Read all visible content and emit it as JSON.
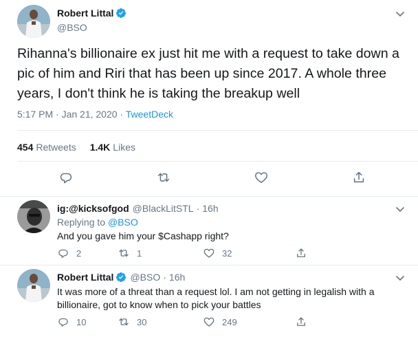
{
  "main_tweet": {
    "author_name": "Robert Littal",
    "author_handle": "@BSO",
    "text": "Rihanna's billionaire ex just hit me with a request to take down a pic of him and Riri that has been up since 2017. A whole three years, I don't think he is taking the breakup well",
    "time": "5:17 PM · Jan 21, 2020",
    "dot": " · ",
    "source": "TweetDeck",
    "retweets_count": "454",
    "retweets_label": "Retweets",
    "likes_count": "1.4K",
    "likes_label": "Likes"
  },
  "replies": [
    {
      "name": "ig:@kicksofgod",
      "handle": "@BlackLitSTL",
      "dot": "·",
      "time": "16h",
      "replying_prefix": "Replying to ",
      "replying_to": "@BSO",
      "text": "And you gave him your $Cashapp right?",
      "reply_count": "2",
      "retweet_count": "1",
      "like_count": "32"
    },
    {
      "name": "Robert Littal",
      "handle": "@BSO",
      "dot": "·",
      "time": "16h",
      "text": "It was more of a threat than a request lol. I am not getting in legalish with a billionaire, got to know when to pick your battles",
      "reply_count": "10",
      "retweet_count": "30",
      "like_count": "249"
    }
  ],
  "icons": {
    "verified": "verified-badge-icon",
    "caret": "chevron-down-icon",
    "reply": "reply-icon",
    "retweet": "retweet-icon",
    "like": "heart-icon",
    "share": "share-icon"
  },
  "colors": {
    "accent": "#1b95e0",
    "verified": "#1da1f2",
    "text": "#14171a",
    "secondary": "#657786",
    "border": "#e6ecf0"
  }
}
